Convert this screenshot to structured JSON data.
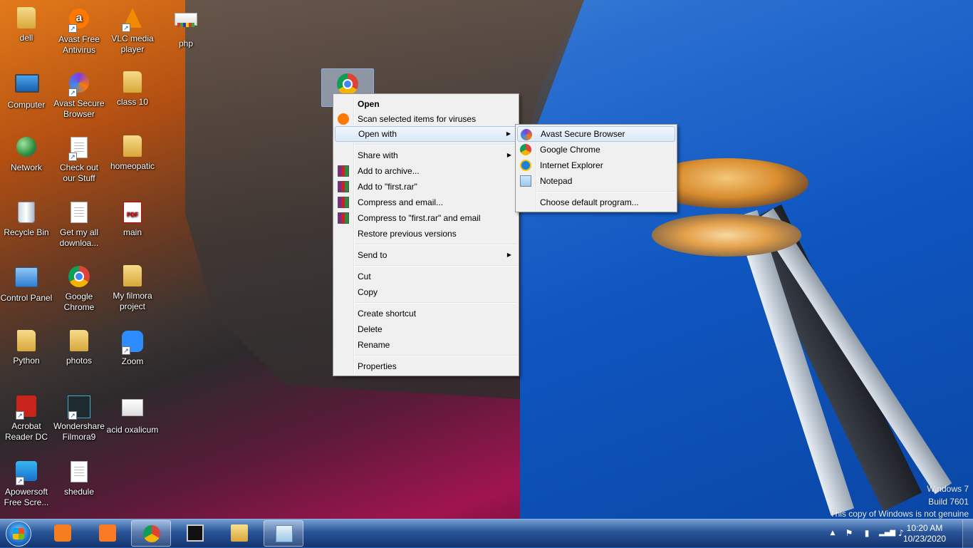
{
  "desktop": {
    "icons": [
      {
        "label": "dell",
        "icon": "folder-icon"
      },
      {
        "label": "Avast Free Antivirus",
        "icon": "avast-icon"
      },
      {
        "label": "VLC media player",
        "icon": "vlc-icon"
      },
      {
        "label": "php",
        "icon": "php-icon"
      },
      {
        "label": "Computer",
        "icon": "computer-icon"
      },
      {
        "label": "Avast Secure Browser",
        "icon": "avast-browser-icon"
      },
      {
        "label": "class 10",
        "icon": "folder-icon"
      },
      {
        "label": "Network",
        "icon": "network-icon"
      },
      {
        "label": "Check out our Stuff",
        "icon": "shortcut-icon"
      },
      {
        "label": "homeopatic",
        "icon": "folder-icon"
      },
      {
        "label": "Recycle Bin",
        "icon": "recycle-bin-icon"
      },
      {
        "label": "Get my all downloa...",
        "icon": "document-icon"
      },
      {
        "label": "main",
        "icon": "pdf-icon"
      },
      {
        "label": "Control Panel",
        "icon": "control-panel-icon"
      },
      {
        "label": "Google Chrome",
        "icon": "chrome-icon"
      },
      {
        "label": "My filmora project",
        "icon": "folder-icon"
      },
      {
        "label": "Python",
        "icon": "folder-icon"
      },
      {
        "label": "photos",
        "icon": "folder-icon"
      },
      {
        "label": "Zoom",
        "icon": "zoom-icon"
      },
      {
        "label": "Acrobat Reader DC",
        "icon": "acrobat-icon"
      },
      {
        "label": "Wondershare Filmora9",
        "icon": "filmora-icon"
      },
      {
        "label": "acid oxalicum",
        "icon": "image-icon"
      },
      {
        "label": "Apowersoft Free Scre...",
        "icon": "apowersoft-icon"
      },
      {
        "label": "shedule",
        "icon": "document-icon"
      }
    ],
    "pdf_badge": "PDF"
  },
  "context_menu": {
    "open": "Open",
    "scan": "Scan selected items for viruses",
    "open_with": "Open with",
    "share_with": "Share with",
    "add_to_archive": "Add to archive...",
    "add_to_rar": "Add to \"first.rar\"",
    "compress_email": "Compress and email...",
    "compress_rar_email": "Compress to \"first.rar\" and email",
    "restore_versions": "Restore previous versions",
    "send_to": "Send to",
    "cut": "Cut",
    "copy": "Copy",
    "create_shortcut": "Create shortcut",
    "delete": "Delete",
    "rename": "Rename",
    "properties": "Properties"
  },
  "open_with_submenu": {
    "items": [
      "Avast Secure Browser",
      "Google Chrome",
      "Internet Explorer",
      "Notepad"
    ],
    "choose_default": "Choose default program..."
  },
  "watermark": {
    "line1": "Windows 7",
    "line2": "Build 7601",
    "line3": "This copy of Windows is not genuine"
  },
  "taskbar": {
    "pinned": [
      "media-player",
      "xampp",
      "google-chrome",
      "cmd",
      "windows-explorer",
      "notepad"
    ],
    "clock_time": "10:20 AM",
    "clock_date": "10/23/2020"
  },
  "colors": {
    "menu_bg": "#f0f0f0",
    "highlight_border": "#a8c8ec",
    "taskbar_top": "#78a0d2",
    "taskbar_bottom": "#14346e"
  }
}
